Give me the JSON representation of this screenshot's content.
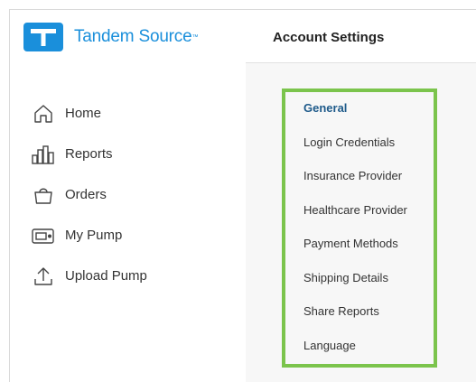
{
  "brand": {
    "name": "Tandem Source",
    "trademark": "™",
    "color": "#1a8fdb"
  },
  "sidebar": {
    "items": [
      {
        "label": "Home",
        "icon": "home-icon"
      },
      {
        "label": "Reports",
        "icon": "bar-chart-icon"
      },
      {
        "label": "Orders",
        "icon": "shopping-bag-icon"
      },
      {
        "label": "My Pump",
        "icon": "pump-icon"
      },
      {
        "label": "Upload Pump",
        "icon": "upload-icon"
      }
    ]
  },
  "header": {
    "title": "Account Settings"
  },
  "settings_menu": {
    "active": "General",
    "items": [
      "General",
      "Login Credentials",
      "Insurance Provider",
      "Healthcare Provider",
      "Payment Methods",
      "Shipping Details",
      "Share Reports",
      "Language"
    ]
  },
  "colors": {
    "highlight": "#7bc44c",
    "active_item": "#1e5a8a",
    "content_bg": "#f7f7f7"
  }
}
